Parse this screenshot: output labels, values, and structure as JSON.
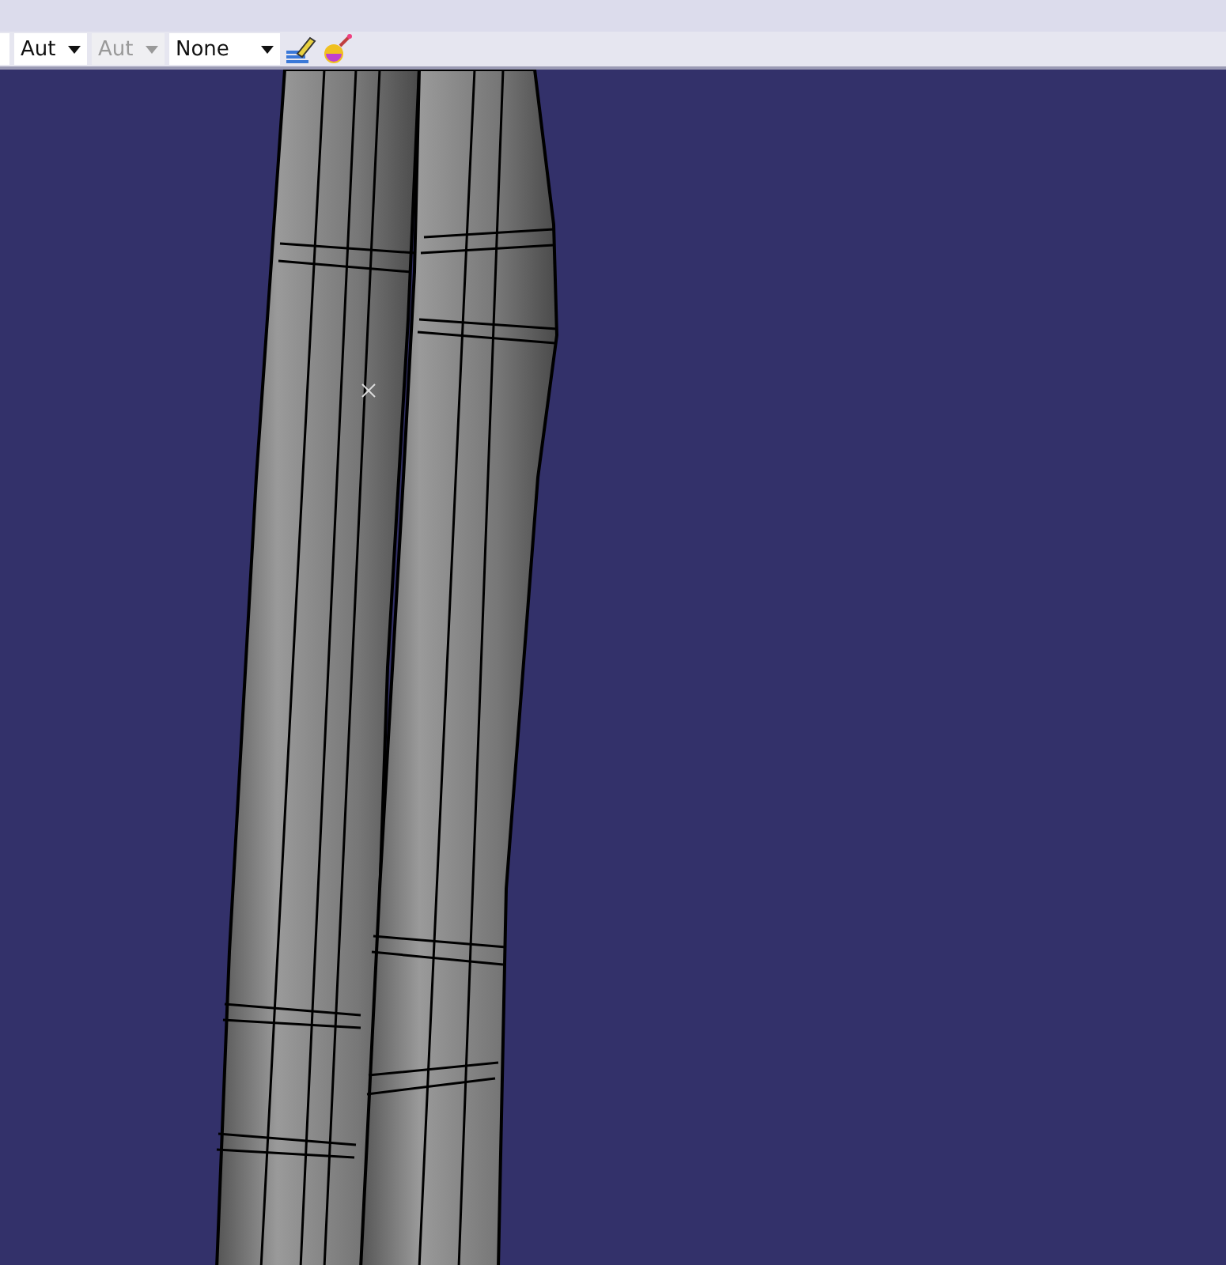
{
  "toolbar": {
    "dropdowns": [
      {
        "value": "Aut",
        "disabled": false
      },
      {
        "value": "Aut",
        "disabled": true
      },
      {
        "value": "None",
        "disabled": false
      }
    ]
  }
}
